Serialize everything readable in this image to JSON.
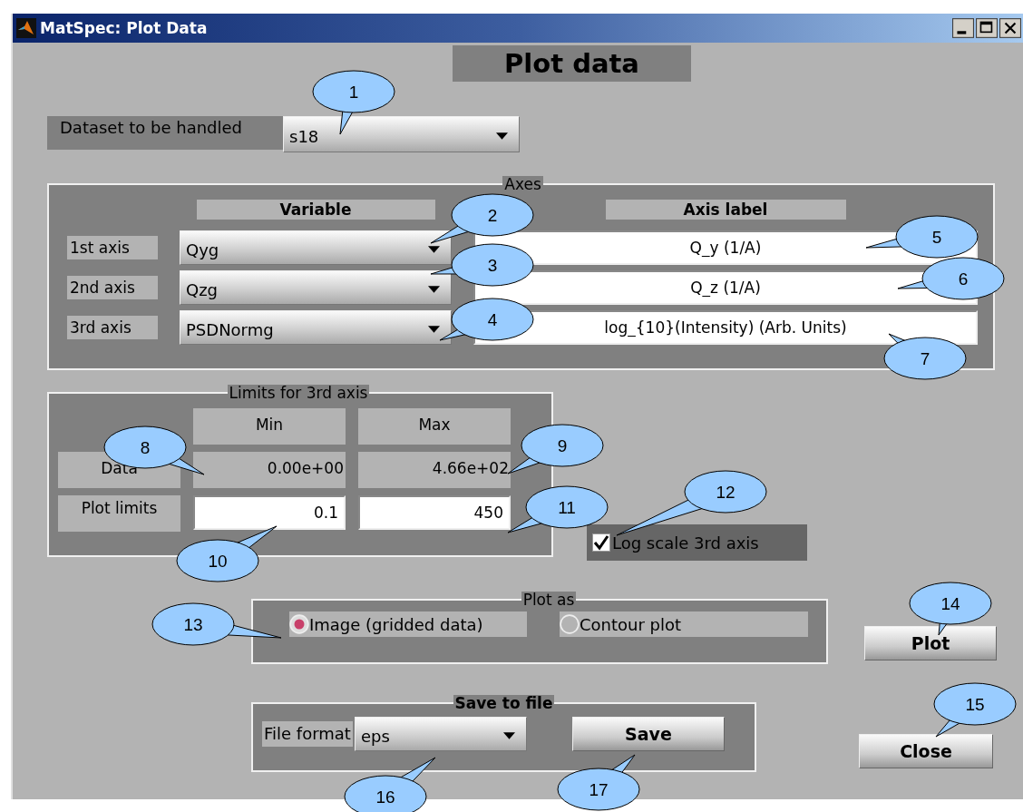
{
  "window": {
    "title": "MatSpec: Plot Data"
  },
  "heading": "Plot data",
  "dataset": {
    "label": "Dataset to be handled",
    "value": "s18"
  },
  "axes": {
    "legend": "Axes",
    "column_headers": [
      "Variable",
      "Axis label"
    ],
    "rows": [
      {
        "label": "1st axis",
        "variable": "Qyg",
        "axis_label": "Q_y (1/A)"
      },
      {
        "label": "2nd axis",
        "variable": "Qzg",
        "axis_label": "Q_z (1/A)"
      },
      {
        "label": "3rd axis",
        "variable": "PSDNormg",
        "axis_label": "log_{10}(Intensity) (Arb. Units)"
      }
    ]
  },
  "limits": {
    "legend": "Limits for 3rd axis",
    "column_headers": [
      "Min",
      "Max"
    ],
    "data": {
      "label": "Data",
      "min": "0.00e+00",
      "max": "4.66e+02"
    },
    "plot_limits": {
      "label": "Plot limits",
      "min": "0.1",
      "max": "450"
    }
  },
  "log_scale": {
    "label": "Log scale 3rd axis",
    "checked": true
  },
  "plot_as": {
    "legend": "Plot as",
    "options": [
      {
        "label": "Image (gridded data)",
        "selected": true
      },
      {
        "label": "Contour plot",
        "selected": false
      }
    ]
  },
  "save": {
    "legend": "Save to file",
    "format_label": "File format",
    "format": "eps",
    "button": "Save"
  },
  "buttons": {
    "plot": "Plot",
    "close": "Close"
  },
  "callouts": [
    {
      "number": "1"
    },
    {
      "number": "2"
    },
    {
      "number": "3"
    },
    {
      "number": "4"
    },
    {
      "number": "5"
    },
    {
      "number": "6"
    },
    {
      "number": "7"
    },
    {
      "number": "8"
    },
    {
      "number": "9"
    },
    {
      "number": "10"
    },
    {
      "number": "11"
    },
    {
      "number": "12"
    },
    {
      "number": "13"
    },
    {
      "number": "14"
    },
    {
      "number": "15"
    },
    {
      "number": "16"
    },
    {
      "number": "17"
    }
  ]
}
